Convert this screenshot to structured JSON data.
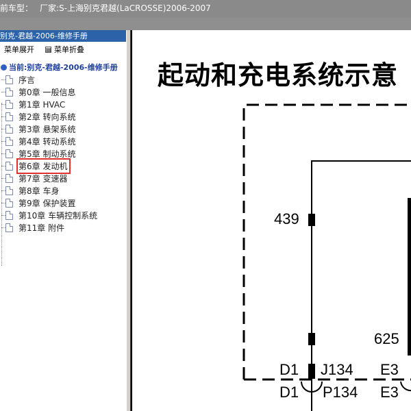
{
  "titlebar": {
    "vehicle_label": "前车型：",
    "maker_label": "厂家:",
    "maker_value": "S-上海别克君越(LaCROSSE)2006-2007"
  },
  "left_panel": {
    "header": "别克-君越-2006-维修手册",
    "menu": {
      "expand": "菜单展开",
      "collapse": "菜单折叠"
    },
    "current_label": "当前:别克-君越-2006-维修手册",
    "items": [
      {
        "label": "序言"
      },
      {
        "label": "第0章 一般信息"
      },
      {
        "label": "第1章 HVAC"
      },
      {
        "label": "第2章 转向系统"
      },
      {
        "label": "第3章 悬架系统"
      },
      {
        "label": "第4章 转动系统"
      },
      {
        "label": "第5章 制动系统"
      },
      {
        "label": "第6章 发动机",
        "selected": true
      },
      {
        "label": "第7章 变速器"
      },
      {
        "label": "第8章 车身"
      },
      {
        "label": "第9章 保护装置"
      },
      {
        "label": "第10章 车辆控制系统"
      },
      {
        "label": "第11章 附件"
      }
    ]
  },
  "diagram": {
    "title": "起动和充电系统示意",
    "labels": {
      "wire_439": "439",
      "wire_625": "625",
      "d1_top": "D1",
      "j134": "J134",
      "e3_top": "E3",
      "d1_bottom": "D1",
      "p134": "P134",
      "e3_bottom": "E3"
    }
  }
}
